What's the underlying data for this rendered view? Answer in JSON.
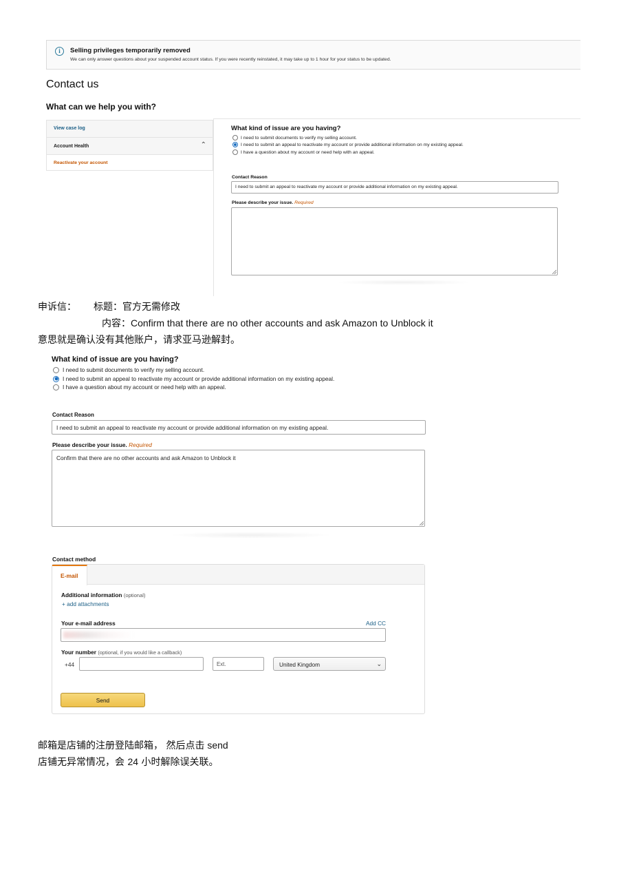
{
  "alert": {
    "icon": "info-icon",
    "icon_glyph": "i",
    "title": "Selling privileges temporarily removed",
    "message": "We can only answer questions about your suspended account status. If you were recently reinstated, it may take up to 1 hour for your status to be updated."
  },
  "page": {
    "title": "Contact us",
    "subtitle": "What can we help you with?"
  },
  "sidebar": {
    "view_case_log": "View case log",
    "account_health": "Account Health",
    "chevron": "⌃",
    "reactivate": "Reactivate your account"
  },
  "issue_form": {
    "question": "What kind of issue are you having?",
    "options": [
      "I need to submit documents to verify my selling account.",
      "I need to submit an appeal to reactivate my account or provide additional information on my existing appeal.",
      "I have a question about my account or need help with an appeal."
    ],
    "selected_index": 1,
    "contact_reason_label": "Contact Reason",
    "contact_reason_value": "I need to submit an appeal to reactivate my account or provide additional information on my existing appeal.",
    "describe_label": "Please describe your issue.",
    "required": "Required",
    "describe_value_first": "",
    "describe_value_second": "Confirm that there are no other accounts and ask Amazon to Unblock it"
  },
  "notes": {
    "appeal_label": "申诉信：",
    "title_line": "标题：官方无需修改",
    "content_prefix": "内容：",
    "content_text": "Confirm that there are no other accounts and ask Amazon to Unblock it",
    "meaning_line": "意思就是确认没有其他账户，请求亚马逊解封。",
    "email_note_prefix": "邮箱是店铺的注册登陆邮箱，   然后点击",
    "email_note_send": " send",
    "result_prefix": "店铺无异常情况，会 ",
    "result_hours": "24",
    "result_suffix": " 小时解除误关联。"
  },
  "contact_method": {
    "label": "Contact method",
    "tab_email": "E-mail",
    "additional_info": "Additional information",
    "optional": "(optional)",
    "add_attachments": "+ add attachments",
    "email_label": "Your e-mail address",
    "add_cc": "Add CC",
    "email_value": "",
    "number_label": "Your number",
    "number_optional": "(optional, if you would like a callback)",
    "country_code": "+44",
    "phone_value": "",
    "ext_placeholder": "Ext.",
    "country": "United Kingdom",
    "dropdown_glyph": "⌄",
    "send": "Send"
  },
  "colors": {
    "link": "#1a5e86",
    "orange": "#c45500",
    "radio_checked": "#1a6ec0",
    "send_button": "#f0c14b"
  }
}
